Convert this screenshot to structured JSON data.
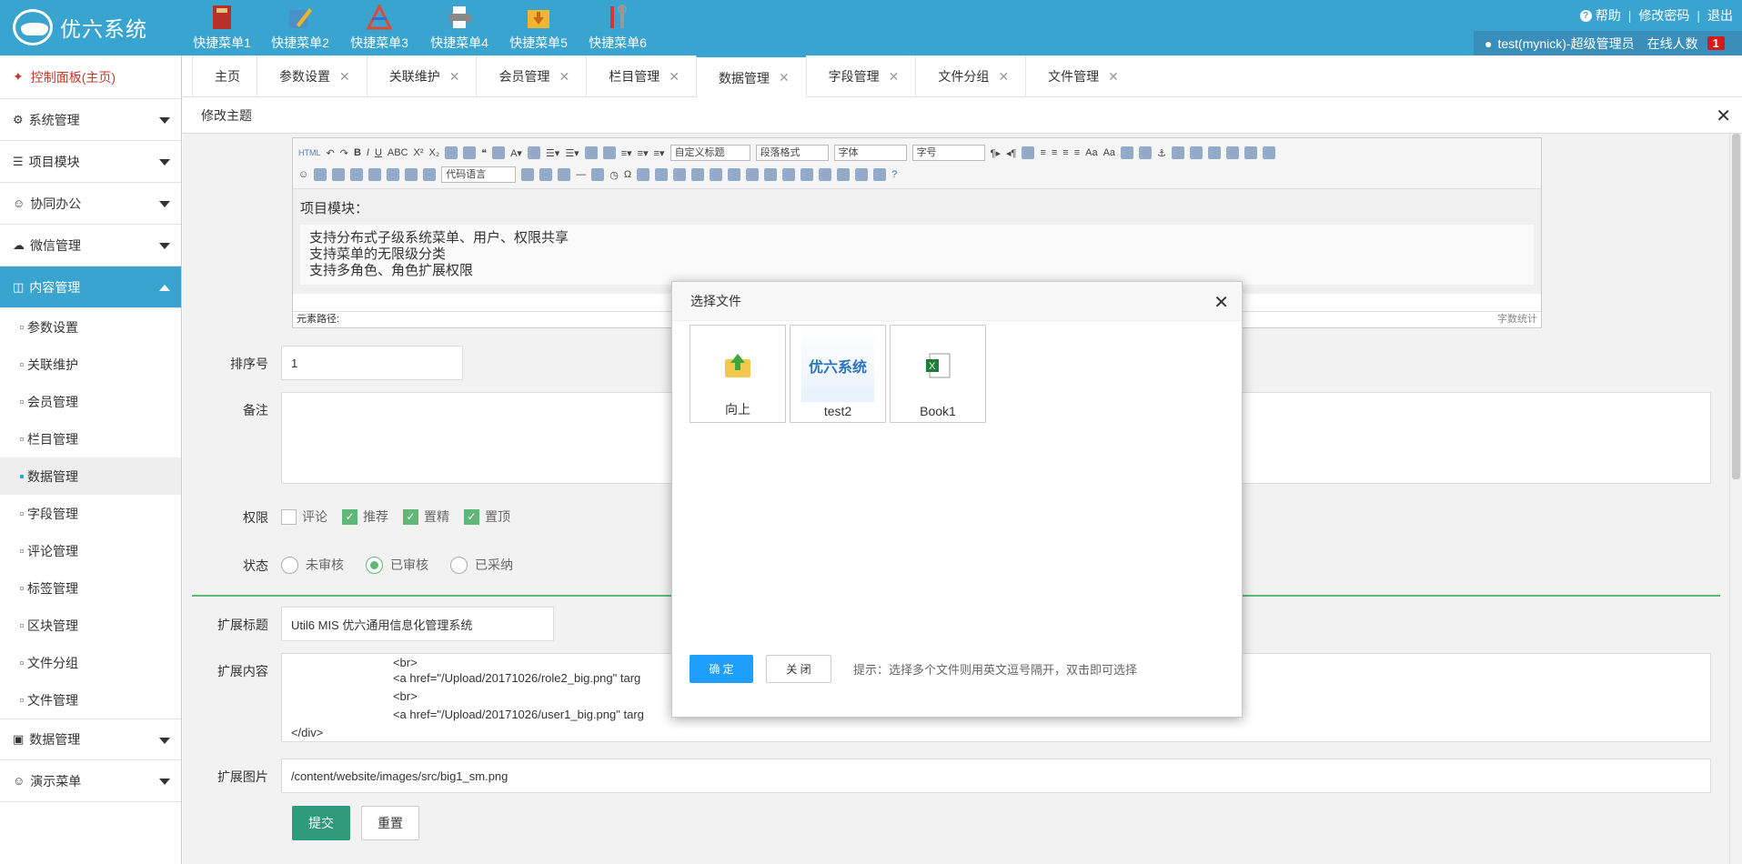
{
  "app": {
    "brand": "优六系统"
  },
  "quick_menu": [
    {
      "label": "快捷菜单1",
      "icon": "book-icon"
    },
    {
      "label": "快捷菜单2",
      "icon": "pencil-icon"
    },
    {
      "label": "快捷菜单3",
      "icon": "tools-icon"
    },
    {
      "label": "快捷菜单4",
      "icon": "printer-icon"
    },
    {
      "label": "快捷菜单5",
      "icon": "download-folder-icon"
    },
    {
      "label": "快捷菜单6",
      "icon": "wrench-icon"
    }
  ],
  "top_links": {
    "help": "帮助",
    "change_password": "修改密码",
    "logout": "退出"
  },
  "user_bar": {
    "user": "test(mynick)-超级管理员",
    "online_label": "在线人数",
    "online_count": "1"
  },
  "sidebar": {
    "home": "控制面板(主页)",
    "groups": [
      {
        "label": "系统管理",
        "icon": "gear-icon"
      },
      {
        "label": "项目模块",
        "icon": "list-icon"
      },
      {
        "label": "协同办公",
        "icon": "users-icon"
      },
      {
        "label": "微信管理",
        "icon": "chat-icon"
      },
      {
        "label": "内容管理",
        "icon": "columns-icon"
      }
    ],
    "content_items": [
      "参数设置",
      "关联维护",
      "会员管理",
      "栏目管理",
      "数据管理",
      "字段管理",
      "评论管理",
      "标签管理",
      "区块管理",
      "文件分组",
      "文件管理"
    ],
    "groups_after": [
      {
        "label": "数据管理",
        "icon": "screen-icon"
      },
      {
        "label": "演示菜单",
        "icon": "smile-icon"
      }
    ]
  },
  "tabs": [
    "主页",
    "参数设置",
    "关联维护",
    "会员管理",
    "栏目管理",
    "数据管理",
    "字段管理",
    "文件分组",
    "文件管理"
  ],
  "subheader": {
    "title": "修改主题"
  },
  "editor": {
    "dropdowns": {
      "heading": "自定义标题",
      "paragraph": "段落格式",
      "font": "字体",
      "size": "字号",
      "code": "代码语言"
    },
    "heading": "项目模块：",
    "lines": [
      "支持分布式子级系统菜单、用户、权限共享",
      "支持菜单的无限级分类",
      "支持多角色、角色扩展权限"
    ],
    "footer_path": "元素路径:",
    "footer_count": "字数统计"
  },
  "form": {
    "sort_label": "排序号",
    "sort_value": "1",
    "remark_label": "备注",
    "perm_label": "权限",
    "perms": [
      {
        "label": "评论",
        "checked": false
      },
      {
        "label": "推荐",
        "checked": true
      },
      {
        "label": "置精",
        "checked": true
      },
      {
        "label": "置顶",
        "checked": true
      }
    ],
    "status_label": "状态",
    "statuses": [
      {
        "label": "未审核",
        "checked": false
      },
      {
        "label": "已审核",
        "checked": true
      },
      {
        "label": "已采纳",
        "checked": false
      }
    ],
    "ext_title_label": "扩展标题",
    "ext_title_value": "Util6 MIS 优六通用信息化管理系统",
    "ext_content_label": "扩展内容",
    "ext_content_lines": [
      "<br>",
      "<a href=\"/Upload/20171026/role2_big.png\" targ",
      "<br>",
      "<a href=\"/Upload/20171026/user1_big.png\" targ",
      "</div>"
    ],
    "ext_image_label": "扩展图片",
    "ext_image_value": "/content/website/images/src/big1_sm.png",
    "submit": "提交",
    "reset": "重置"
  },
  "modal": {
    "title": "选择文件",
    "files": [
      {
        "label": "向上",
        "icon": "folder-up-icon"
      },
      {
        "label": "test2",
        "icon": "image-thumbnail",
        "thumb_text": "优六系统"
      },
      {
        "label": "Book1",
        "icon": "excel-icon"
      }
    ],
    "confirm": "确 定",
    "close": "关 闭",
    "hint": "提示：选择多个文件则用英文逗号隔开，双击即可选择"
  }
}
